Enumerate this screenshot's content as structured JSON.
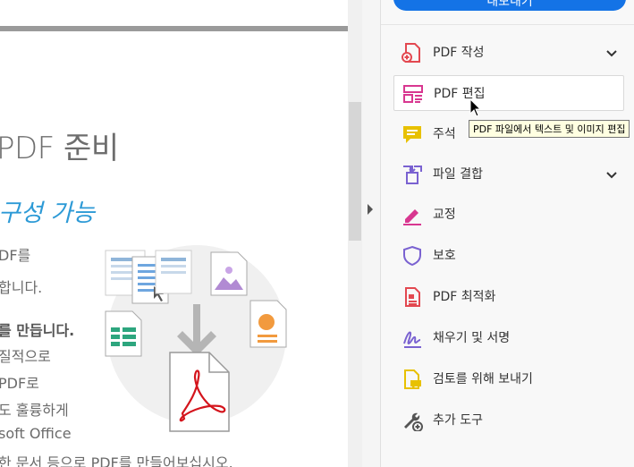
{
  "document": {
    "heading": "PDF 준비",
    "subheading": "구성 가능",
    "lines": [
      {
        "text": "DF를",
        "bold": false
      },
      {
        "text": "합니다.",
        "bold": false
      },
      {
        "text": "를 만듭니다.",
        "bold": true
      },
      {
        "text": "질적으로",
        "bold": false
      },
      {
        "text": "PDF로",
        "bold": false
      },
      {
        "text": "도 훌륭하게",
        "bold": false
      },
      {
        "text": "soft Office",
        "bold": false
      },
      {
        "text": "한 문서 등으로 PDF를 만들어보십시오.",
        "bold": false
      }
    ]
  },
  "pane": {
    "top_button_label": "내보내기",
    "tools": [
      {
        "label": "PDF 작성",
        "icon": "create-pdf-icon",
        "color": "#e34850",
        "chevron": true
      },
      {
        "label": "PDF 편집",
        "icon": "edit-pdf-icon",
        "color": "#d83790",
        "chevron": false,
        "highlighted": true
      },
      {
        "label": "주석",
        "icon": "comment-icon",
        "color": "#e8c100",
        "chevron": false
      },
      {
        "label": "파일 결합",
        "icon": "combine-files-icon",
        "color": "#7a62d1",
        "chevron": true
      },
      {
        "label": "교정",
        "icon": "redact-icon",
        "color": "#d83790",
        "chevron": false
      },
      {
        "label": "보호",
        "icon": "protect-icon",
        "color": "#7a62d1",
        "chevron": false
      },
      {
        "label": "PDF 최적화",
        "icon": "optimize-pdf-icon",
        "color": "#e34850",
        "chevron": false
      },
      {
        "label": "채우기 및 서명",
        "icon": "fill-sign-icon",
        "color": "#7a62d1",
        "chevron": false
      },
      {
        "label": "검토를 위해 보내기",
        "icon": "send-for-review-icon",
        "color": "#e8c100",
        "chevron": false
      },
      {
        "label": "추가 도구",
        "icon": "more-tools-icon",
        "color": "#555555",
        "chevron": false
      }
    ]
  },
  "tooltip": "PDF 파일에서 텍스트 및 이미지 편집"
}
